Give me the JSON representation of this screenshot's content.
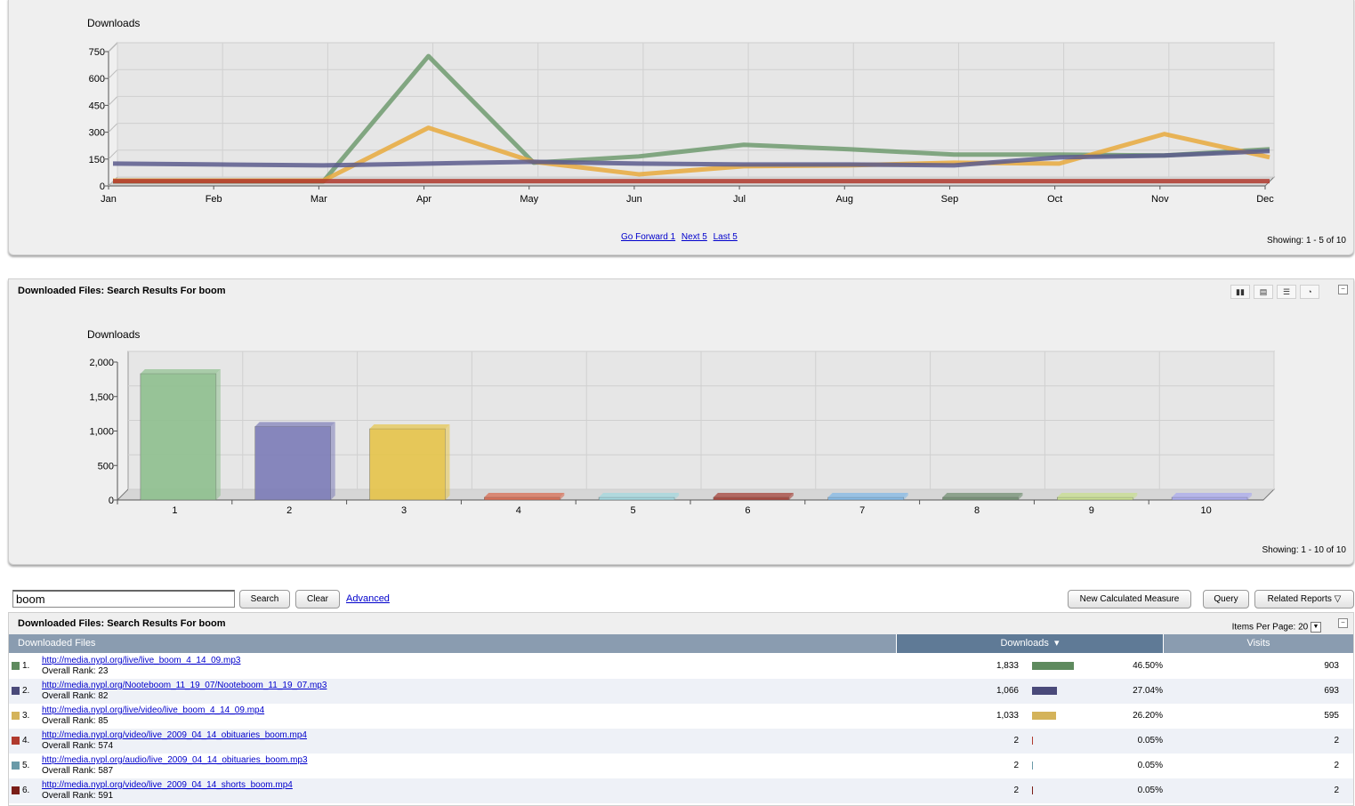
{
  "line_chart": {
    "showing": "Showing: 1 - 5 of 10",
    "pager": {
      "forward": "Go Forward 1",
      "next": "Next 5",
      "last": "Last 5"
    },
    "chart_data": {
      "type": "line",
      "ylabel": "Downloads",
      "ylim": [
        0,
        750
      ],
      "yticks": [
        "750",
        "600",
        "450",
        "300",
        "150",
        "0"
      ],
      "categories": [
        "Jan",
        "Feb",
        "Mar",
        "Apr",
        "May",
        "Jun",
        "Jul",
        "Aug",
        "Sep",
        "Oct",
        "Nov",
        "Dec"
      ],
      "series": [
        {
          "color": "#6e9a6e",
          "values": [
            0,
            0,
            0,
            700,
            105,
            140,
            205,
            180,
            150,
            150,
            145,
            180
          ]
        },
        {
          "color": "#e8a93c",
          "values": [
            5,
            5,
            5,
            300,
            110,
            40,
            85,
            90,
            105,
            100,
            265,
            135
          ]
        },
        {
          "color": "#5a5a8c",
          "values": [
            100,
            95,
            90,
            100,
            110,
            100,
            95,
            95,
            90,
            135,
            145,
            170
          ]
        },
        {
          "color": "#b03a2e",
          "values": [
            2,
            2,
            2,
            2,
            2,
            2,
            2,
            2,
            2,
            2,
            2,
            2
          ]
        }
      ]
    }
  },
  "bar_chart": {
    "title": "Downloaded Files: Search Results For boom",
    "showing": "Showing: 1 - 10 of 10",
    "chart_data": {
      "type": "bar",
      "ylabel": "Downloads",
      "ylim": [
        0,
        2000
      ],
      "yticks": [
        "2,000",
        "1,500",
        "1,000",
        "500",
        "0"
      ],
      "categories": [
        "1",
        "2",
        "3",
        "4",
        "5",
        "6",
        "7",
        "8",
        "9",
        "10"
      ],
      "values": [
        1833,
        1066,
        1033,
        2,
        2,
        2,
        2,
        2,
        2,
        2
      ],
      "colors": [
        "#8fc08f",
        "#7c7cb8",
        "#e6c44a",
        "#d9664a",
        "#9fd8e0",
        "#a33a30",
        "#7fb8e8",
        "#6e8c6e",
        "#c8e08a",
        "#a8a8f0"
      ]
    }
  },
  "search": {
    "value": "boom",
    "search_label": "Search",
    "clear_label": "Clear",
    "advanced_label": "Advanced",
    "new_measure_label": "New Calculated Measure",
    "query_label": "Query",
    "related_label": "Related Reports"
  },
  "table": {
    "title": "Downloaded Files: Search Results For boom",
    "items_per_page_label": "Items Per Page:",
    "items_per_page": "20",
    "col_files": "Downloaded Files",
    "col_downloads": "Downloads",
    "col_visits": "Visits",
    "rows": [
      {
        "num": "1.",
        "color": "#5e8a5e",
        "url": "http://media.nypl.org/live/live_boom_4_14_09.mp3",
        "rank": "Overall Rank: 23",
        "downloads": "1,833",
        "pct": "46.50%",
        "share": 0.465,
        "visits": "903"
      },
      {
        "num": "2.",
        "color": "#4a4a7a",
        "url": "http://media.nypl.org/Nooteboom_11_19_07/Nooteboom_11_19_07.mp3",
        "rank": "Overall Rank: 82",
        "downloads": "1,066",
        "pct": "27.04%",
        "share": 0.2704,
        "visits": "693"
      },
      {
        "num": "3.",
        "color": "#d4b35a",
        "url": "http://media.nypl.org/live/video/live_boom_4_14_09.mp4",
        "rank": "Overall Rank: 85",
        "downloads": "1,033",
        "pct": "26.20%",
        "share": 0.262,
        "visits": "595"
      },
      {
        "num": "4.",
        "color": "#b03a2e",
        "url": "http://media.nypl.org/video/live_2009_04_14_obituaries_boom.mp4",
        "rank": "Overall Rank: 574",
        "downloads": "2",
        "pct": "0.05%",
        "share": 0.0005,
        "visits": "2"
      },
      {
        "num": "5.",
        "color": "#6a9aa8",
        "url": "http://media.nypl.org/audio/live_2009_04_14_obituaries_boom.mp3",
        "rank": "Overall Rank: 587",
        "downloads": "2",
        "pct": "0.05%",
        "share": 0.0005,
        "visits": "2"
      },
      {
        "num": "6.",
        "color": "#7a1e18",
        "url": "http://media.nypl.org/video/live_2009_04_14_shorts_boom.mp4",
        "rank": "Overall Rank: 591",
        "downloads": "2",
        "pct": "0.05%",
        "share": 0.0005,
        "visits": "2"
      }
    ]
  }
}
